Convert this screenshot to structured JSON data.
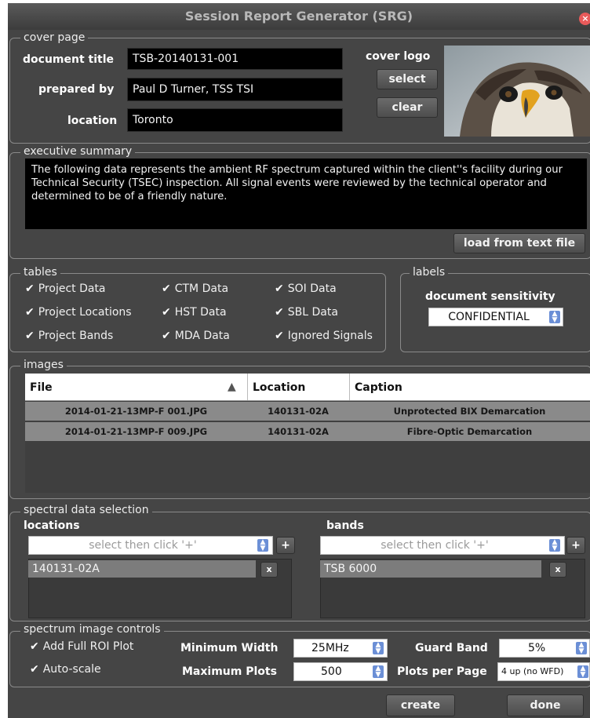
{
  "window": {
    "title": "Session Report Generator (SRG)"
  },
  "cover_page": {
    "legend": "cover page",
    "document_title_label": "document title",
    "document_title_value": "TSB-20140131-001",
    "prepared_by_label": "prepared by",
    "prepared_by_value": "Paul D Turner, TSS TSI",
    "location_label": "location",
    "location_value": "Toronto",
    "cover_logo_label": "cover logo",
    "select_label": "select",
    "clear_label": "clear"
  },
  "executive_summary": {
    "legend": "executive summary",
    "text": "The following data represents the ambient RF spectrum captured within the client''s facility during our Technical Security (TSEC) inspection. All signal events were reviewed by the technical operator and determined to be of a friendly nature.",
    "load_button": "load from text file"
  },
  "tables": {
    "legend": "tables",
    "items": [
      {
        "label": "Project Data",
        "checked": true
      },
      {
        "label": "CTM Data",
        "checked": true
      },
      {
        "label": "SOI Data",
        "checked": true
      },
      {
        "label": "Project Locations",
        "checked": true
      },
      {
        "label": "HST Data",
        "checked": true
      },
      {
        "label": "SBL Data",
        "checked": true
      },
      {
        "label": "Project Bands",
        "checked": true
      },
      {
        "label": "MDA Data",
        "checked": true
      },
      {
        "label": "Ignored Signals",
        "checked": true
      }
    ],
    "check_glyph": "✔"
  },
  "labels": {
    "legend": "labels",
    "sensitivity_label": "document sensitivity",
    "sensitivity_value": "CONFIDENTIAL"
  },
  "images": {
    "legend": "images",
    "columns": [
      "File",
      "Location",
      "Caption"
    ],
    "sort_glyph": "▲",
    "rows": [
      {
        "file": "2014-01-21-13MP-F 001.JPG",
        "location": "140131-02A",
        "caption": "Unprotected BIX Demarcation"
      },
      {
        "file": "2014-01-21-13MP-F 009.JPG",
        "location": "140131-02A",
        "caption": "Fibre-Optic Demarcation"
      }
    ]
  },
  "spectral": {
    "legend": "spectral data selection",
    "locations_label": "locations",
    "locations_placeholder": "select then click '+'",
    "locations_item": "140131-02A",
    "bands_label": "bands",
    "bands_placeholder": "select then click '+'",
    "bands_item": "TSB 6000",
    "plus": "+",
    "remove": "x"
  },
  "spectrum_controls": {
    "legend": "spectrum image controls",
    "add_full_roi": "Add Full ROI Plot",
    "auto_scale": "Auto-scale",
    "min_width_label": "Minimum Width",
    "min_width_value": "25MHz",
    "max_plots_label": "Maximum Plots",
    "max_plots_value": "500",
    "guard_band_label": "Guard Band",
    "guard_band_value": "5%",
    "plots_per_page_label": "Plots per Page",
    "plots_per_page_value": "4 up (no WFD)"
  },
  "footer": {
    "create": "create",
    "done": "done"
  }
}
